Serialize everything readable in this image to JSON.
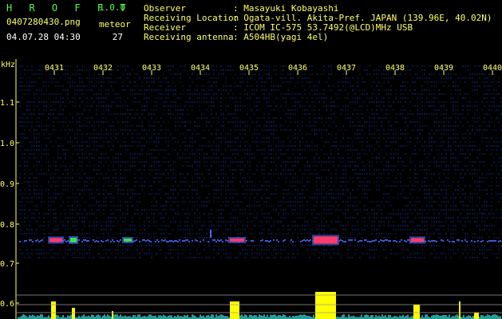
{
  "header": {
    "app_title": "H R O F F T",
    "app_version": "1.0.0",
    "file_name": "0407280430.png",
    "meteor_label": "meteor",
    "datetime": "04.07.28 04:30",
    "meteor_count": "27"
  },
  "info": [
    {
      "label": "Observer",
      "value": ": Masayuki Kobayashi"
    },
    {
      "label": "Receiving Location",
      "value": ": Ogata-vill. Akita-Pref. JAPAN (139.96E, 40.02N)"
    },
    {
      "label": "Receiver",
      "value": ": ICOM IC-575 53.7492(@LCD)MHz USB"
    },
    {
      "label": "Receiving antenna",
      "value": ": A504HB(yagi 4el)"
    }
  ],
  "spectrogram": {
    "freq_unit": "kHz",
    "freq_ticks": [
      "1.1",
      "1.0",
      "0.9",
      "0.8",
      "0.7",
      "0.6"
    ],
    "time_ticks": [
      "0431",
      "0432",
      "0433",
      "0434",
      "0435",
      "0436",
      "0437",
      "0438",
      "0439",
      "0440"
    ],
    "colors": {
      "background": "#000000",
      "noise": "#1a2a80",
      "signal_line": "#4a6cff",
      "echo_hot": "#ff3a6a",
      "echo_mid": "#39e04a",
      "bars": "#ffff00",
      "noise_floor": "#2ec4c4"
    }
  }
}
